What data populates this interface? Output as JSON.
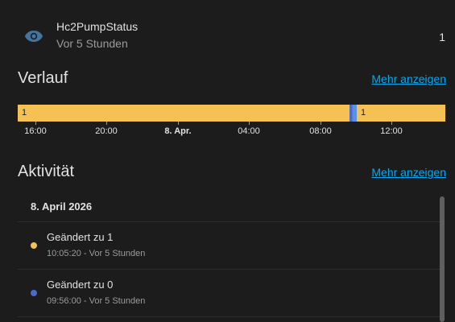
{
  "entity": {
    "name": "Hc2PumpStatus",
    "last_changed": "Vor 5 Stunden",
    "state": "1",
    "icon": "eye-icon",
    "icon_color": "#44739e"
  },
  "history": {
    "title": "Verlauf",
    "more_label": "Mehr anzeigen",
    "colors": {
      "state_1": "#f4c152",
      "state_0": "#4a6bc9",
      "separator": "#5f8fe0"
    },
    "segments": [
      {
        "state": "1",
        "label": "1",
        "start_fraction": 0.0,
        "end_fraction": 0.776
      },
      {
        "state": "0",
        "label": "",
        "start_fraction": 0.776,
        "end_fraction": 0.793
      },
      {
        "state": "1",
        "label": "1",
        "start_fraction": 0.793,
        "end_fraction": 1.0
      }
    ],
    "ticks": [
      {
        "label": "16:00",
        "bold": false
      },
      {
        "label": "20:00",
        "bold": false
      },
      {
        "label": "8. Apr.",
        "bold": true
      },
      {
        "label": "04:00",
        "bold": false
      },
      {
        "label": "08:00",
        "bold": false
      },
      {
        "label": "12:00",
        "bold": false
      }
    ]
  },
  "activity": {
    "title": "Aktivität",
    "more_label": "Mehr anzeigen",
    "date_header": "8. April 2026",
    "entries": [
      {
        "title": "Geändert zu 1",
        "time": "10:05:20 - Vor 5 Stunden",
        "dot_color": "#f4c152"
      },
      {
        "title": "Geändert zu 0",
        "time": "09:56:00 - Vor 5 Stunden",
        "dot_color": "#4a6bc9"
      }
    ]
  }
}
